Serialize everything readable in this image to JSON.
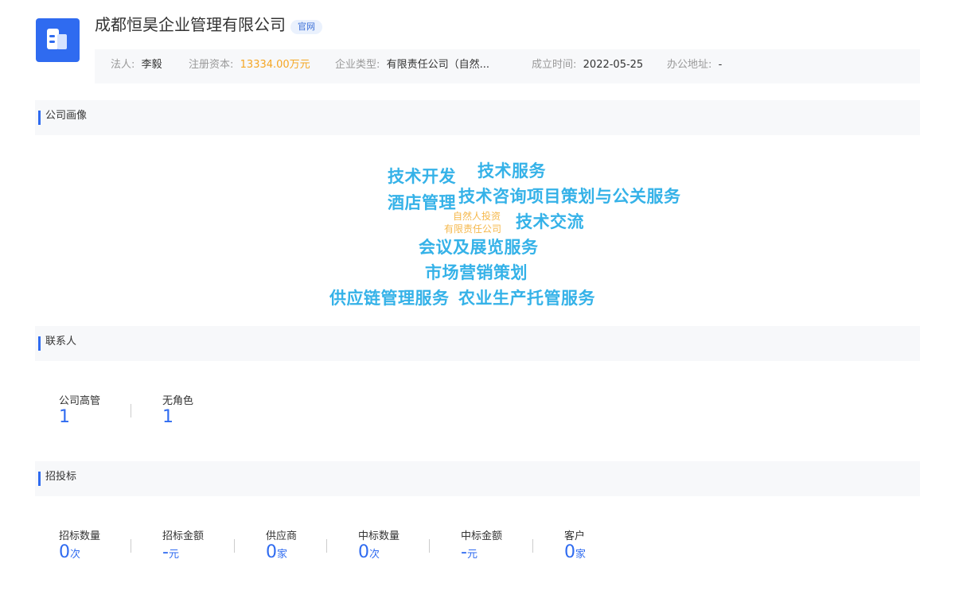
{
  "company": {
    "name": "成都恒昊企业管理有限公司",
    "official_badge": "官网",
    "logo_icon": "building-icon",
    "brand_color": "#2f6bf0"
  },
  "info": {
    "legal_person_label": "法人:",
    "legal_person": "李毅",
    "capital_label": "注册资本:",
    "capital": "13334.00万元",
    "type_label": "企业类型:",
    "type": "有限责任公司（自然...",
    "founded_label": "成立时间:",
    "founded": "2022-05-25",
    "address_label": "办公地址:",
    "address": "-"
  },
  "sections": {
    "portrait": "公司画像",
    "contacts": "联系人",
    "bidding": "招投标"
  },
  "word_cloud": [
    "技术开发",
    "技术服务",
    "酒店管理",
    "技术咨询项目策划与公关服务",
    "自然人投资",
    "有限责任公司",
    "技术交流",
    "会议及展览服务",
    "市场营销策划",
    "供应链管理服务",
    "农业生产托管服务"
  ],
  "contacts": [
    {
      "label": "公司高管",
      "value": "1"
    },
    {
      "label": "无角色",
      "value": "1"
    }
  ],
  "bidding": [
    {
      "label": "招标数量",
      "value": "0",
      "unit": "次"
    },
    {
      "label": "招标金额",
      "value": "-",
      "unit": "元"
    },
    {
      "label": "供应商",
      "value": "0",
      "unit": "家"
    },
    {
      "label": "中标数量",
      "value": "0",
      "unit": "次"
    },
    {
      "label": "中标金额",
      "value": "-",
      "unit": "元"
    },
    {
      "label": "客户",
      "value": "0",
      "unit": "家"
    }
  ]
}
